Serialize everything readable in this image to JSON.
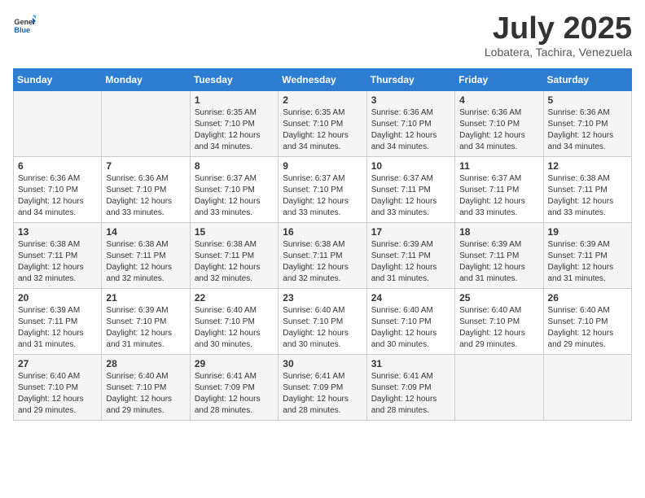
{
  "logo": {
    "line1": "General",
    "line2": "Blue"
  },
  "title": "July 2025",
  "location": "Lobatera, Tachira, Venezuela",
  "days_of_week": [
    "Sunday",
    "Monday",
    "Tuesday",
    "Wednesday",
    "Thursday",
    "Friday",
    "Saturday"
  ],
  "weeks": [
    [
      {
        "day": "",
        "info": ""
      },
      {
        "day": "",
        "info": ""
      },
      {
        "day": "1",
        "info": "Sunrise: 6:35 AM\nSunset: 7:10 PM\nDaylight: 12 hours and 34 minutes."
      },
      {
        "day": "2",
        "info": "Sunrise: 6:35 AM\nSunset: 7:10 PM\nDaylight: 12 hours and 34 minutes."
      },
      {
        "day": "3",
        "info": "Sunrise: 6:36 AM\nSunset: 7:10 PM\nDaylight: 12 hours and 34 minutes."
      },
      {
        "day": "4",
        "info": "Sunrise: 6:36 AM\nSunset: 7:10 PM\nDaylight: 12 hours and 34 minutes."
      },
      {
        "day": "5",
        "info": "Sunrise: 6:36 AM\nSunset: 7:10 PM\nDaylight: 12 hours and 34 minutes."
      }
    ],
    [
      {
        "day": "6",
        "info": "Sunrise: 6:36 AM\nSunset: 7:10 PM\nDaylight: 12 hours and 34 minutes."
      },
      {
        "day": "7",
        "info": "Sunrise: 6:36 AM\nSunset: 7:10 PM\nDaylight: 12 hours and 33 minutes."
      },
      {
        "day": "8",
        "info": "Sunrise: 6:37 AM\nSunset: 7:10 PM\nDaylight: 12 hours and 33 minutes."
      },
      {
        "day": "9",
        "info": "Sunrise: 6:37 AM\nSunset: 7:10 PM\nDaylight: 12 hours and 33 minutes."
      },
      {
        "day": "10",
        "info": "Sunrise: 6:37 AM\nSunset: 7:11 PM\nDaylight: 12 hours and 33 minutes."
      },
      {
        "day": "11",
        "info": "Sunrise: 6:37 AM\nSunset: 7:11 PM\nDaylight: 12 hours and 33 minutes."
      },
      {
        "day": "12",
        "info": "Sunrise: 6:38 AM\nSunset: 7:11 PM\nDaylight: 12 hours and 33 minutes."
      }
    ],
    [
      {
        "day": "13",
        "info": "Sunrise: 6:38 AM\nSunset: 7:11 PM\nDaylight: 12 hours and 32 minutes."
      },
      {
        "day": "14",
        "info": "Sunrise: 6:38 AM\nSunset: 7:11 PM\nDaylight: 12 hours and 32 minutes."
      },
      {
        "day": "15",
        "info": "Sunrise: 6:38 AM\nSunset: 7:11 PM\nDaylight: 12 hours and 32 minutes."
      },
      {
        "day": "16",
        "info": "Sunrise: 6:38 AM\nSunset: 7:11 PM\nDaylight: 12 hours and 32 minutes."
      },
      {
        "day": "17",
        "info": "Sunrise: 6:39 AM\nSunset: 7:11 PM\nDaylight: 12 hours and 31 minutes."
      },
      {
        "day": "18",
        "info": "Sunrise: 6:39 AM\nSunset: 7:11 PM\nDaylight: 12 hours and 31 minutes."
      },
      {
        "day": "19",
        "info": "Sunrise: 6:39 AM\nSunset: 7:11 PM\nDaylight: 12 hours and 31 minutes."
      }
    ],
    [
      {
        "day": "20",
        "info": "Sunrise: 6:39 AM\nSunset: 7:11 PM\nDaylight: 12 hours and 31 minutes."
      },
      {
        "day": "21",
        "info": "Sunrise: 6:39 AM\nSunset: 7:10 PM\nDaylight: 12 hours and 31 minutes."
      },
      {
        "day": "22",
        "info": "Sunrise: 6:40 AM\nSunset: 7:10 PM\nDaylight: 12 hours and 30 minutes."
      },
      {
        "day": "23",
        "info": "Sunrise: 6:40 AM\nSunset: 7:10 PM\nDaylight: 12 hours and 30 minutes."
      },
      {
        "day": "24",
        "info": "Sunrise: 6:40 AM\nSunset: 7:10 PM\nDaylight: 12 hours and 30 minutes."
      },
      {
        "day": "25",
        "info": "Sunrise: 6:40 AM\nSunset: 7:10 PM\nDaylight: 12 hours and 29 minutes."
      },
      {
        "day": "26",
        "info": "Sunrise: 6:40 AM\nSunset: 7:10 PM\nDaylight: 12 hours and 29 minutes."
      }
    ],
    [
      {
        "day": "27",
        "info": "Sunrise: 6:40 AM\nSunset: 7:10 PM\nDaylight: 12 hours and 29 minutes."
      },
      {
        "day": "28",
        "info": "Sunrise: 6:40 AM\nSunset: 7:10 PM\nDaylight: 12 hours and 29 minutes."
      },
      {
        "day": "29",
        "info": "Sunrise: 6:41 AM\nSunset: 7:09 PM\nDaylight: 12 hours and 28 minutes."
      },
      {
        "day": "30",
        "info": "Sunrise: 6:41 AM\nSunset: 7:09 PM\nDaylight: 12 hours and 28 minutes."
      },
      {
        "day": "31",
        "info": "Sunrise: 6:41 AM\nSunset: 7:09 PM\nDaylight: 12 hours and 28 minutes."
      },
      {
        "day": "",
        "info": ""
      },
      {
        "day": "",
        "info": ""
      }
    ]
  ]
}
